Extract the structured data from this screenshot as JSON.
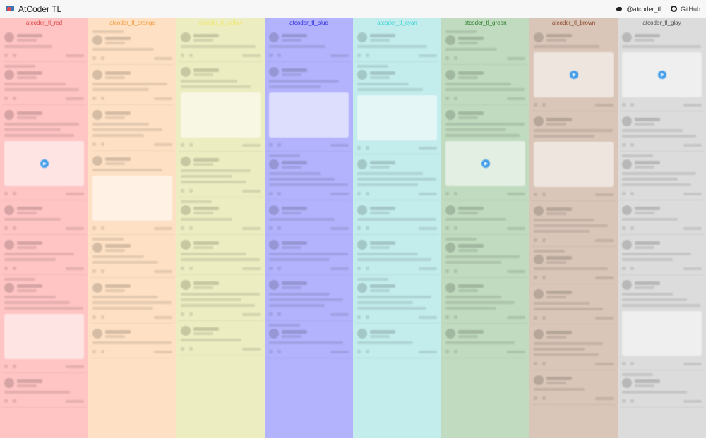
{
  "header": {
    "title": "AtCoder TL",
    "twitter_label": "@atcoder_tl",
    "github_label": "GitHub"
  },
  "columns": [
    {
      "label": "atcoder_tl_red",
      "bg": "#ffc4c4",
      "text": "#e04545"
    },
    {
      "label": "atcoder_tl_orange",
      "bg": "#fee1c4",
      "text": "#ef9a3b"
    },
    {
      "label": "atcoder_tl_yellow",
      "bg": "#ededc2",
      "text": "#efe86a"
    },
    {
      "label": "atcoder_tl_blue",
      "bg": "#b3b3fd",
      "text": "#2b2bdd"
    },
    {
      "label": "atcoder_tl_cyan",
      "bg": "#c3ecec",
      "text": "#39d4d4"
    },
    {
      "label": "atcoder_tl_green",
      "bg": "#c0dbbf",
      "text": "#2a7b2a"
    },
    {
      "label": "atcoder_tl_brown",
      "bg": "#dac6b8",
      "text": "#8a4a2b"
    },
    {
      "label": "atcoder_tl_glay",
      "bg": "#dcdcdc",
      "text": "#555555"
    }
  ]
}
